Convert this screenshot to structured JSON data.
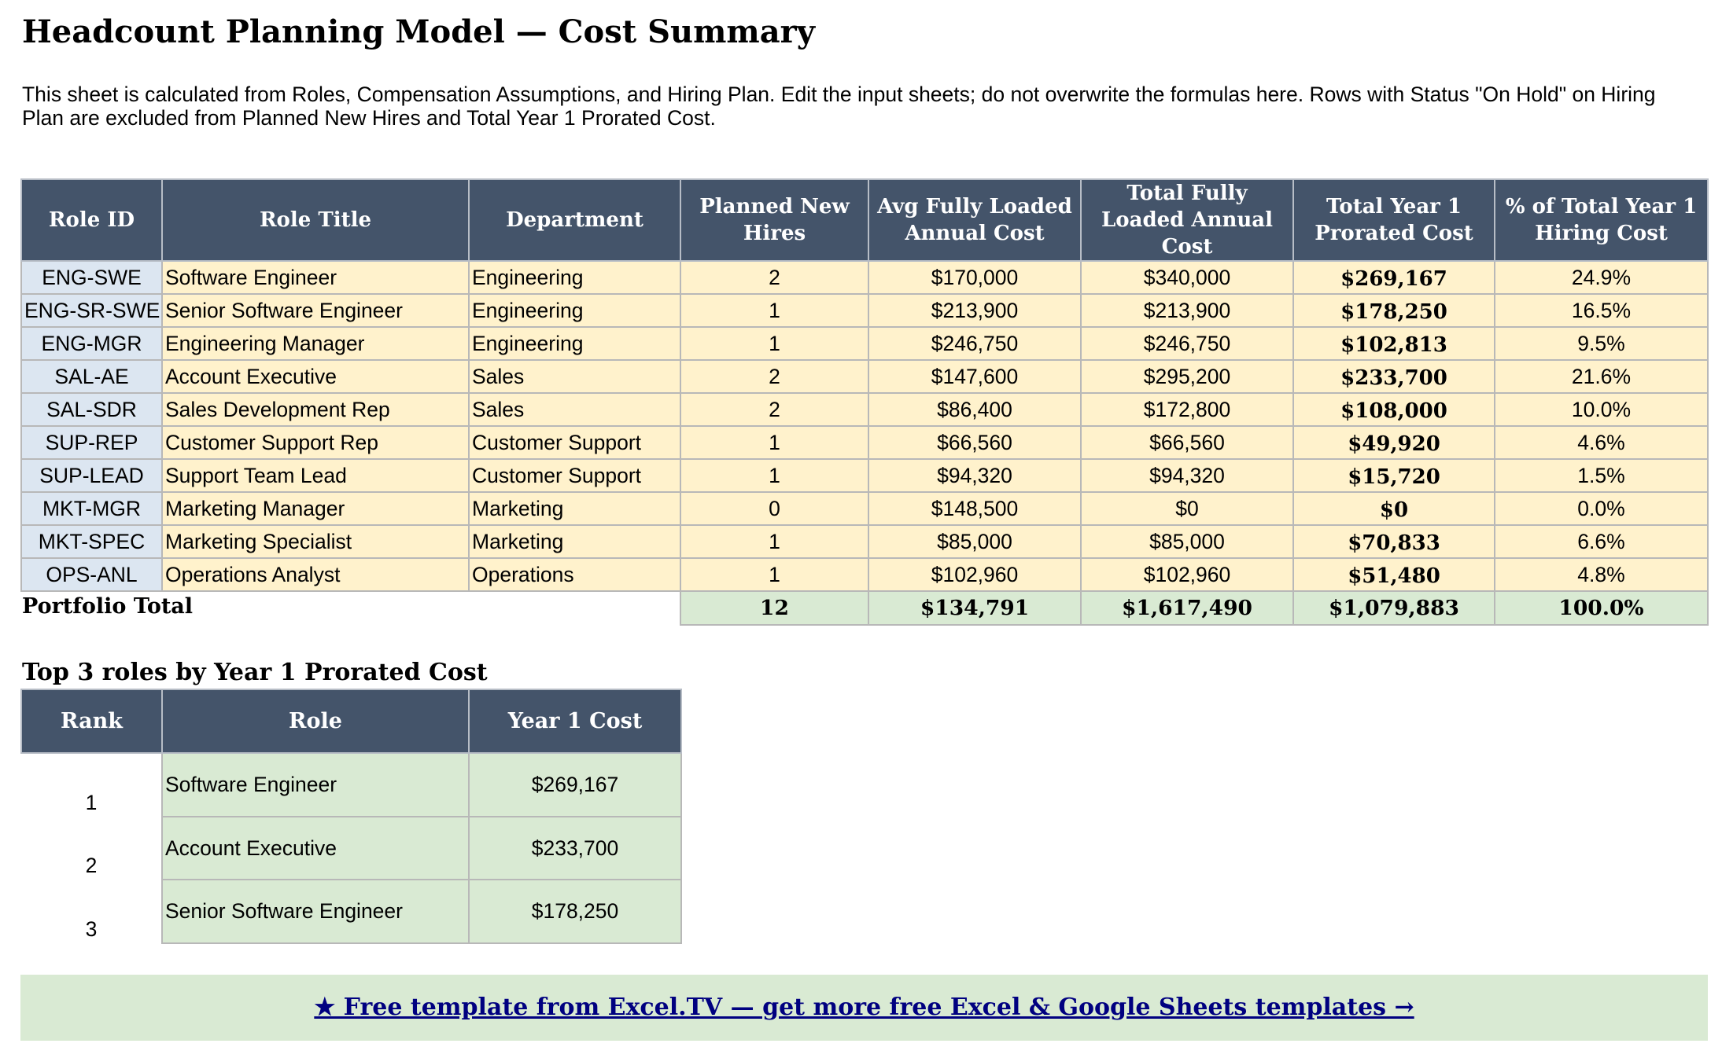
{
  "title": "Headcount Planning Model — Cost Summary",
  "description": "This sheet is calculated from Roles, Compensation Assumptions, and Hiring Plan. Edit the input sheets; do not overwrite the formulas here. Rows with Status \"On Hold\" on Hiring Plan are excluded from Planned New Hires and Total Year 1 Prorated Cost.",
  "columns": [
    "Role ID",
    "Role Title",
    "Department",
    "Planned New Hires",
    "Avg Fully Loaded Annual Cost",
    "Total Fully Loaded Annual Cost",
    "Total Year 1 Prorated Cost",
    "% of Total Year 1 Hiring Cost"
  ],
  "rows": [
    {
      "id": "ENG-SWE",
      "title": "Software Engineer",
      "dept": "Engineering",
      "hires": "2",
      "avg": "$170,000",
      "total": "$340,000",
      "year1": "$269,167",
      "pct": "24.9%"
    },
    {
      "id": "ENG-SR-SWE",
      "title": "Senior Software Engineer",
      "dept": "Engineering",
      "hires": "1",
      "avg": "$213,900",
      "total": "$213,900",
      "year1": "$178,250",
      "pct": "16.5%"
    },
    {
      "id": "ENG-MGR",
      "title": "Engineering Manager",
      "dept": "Engineering",
      "hires": "1",
      "avg": "$246,750",
      "total": "$246,750",
      "year1": "$102,813",
      "pct": "9.5%"
    },
    {
      "id": "SAL-AE",
      "title": "Account Executive",
      "dept": "Sales",
      "hires": "2",
      "avg": "$147,600",
      "total": "$295,200",
      "year1": "$233,700",
      "pct": "21.6%"
    },
    {
      "id": "SAL-SDR",
      "title": "Sales Development Rep",
      "dept": "Sales",
      "hires": "2",
      "avg": "$86,400",
      "total": "$172,800",
      "year1": "$108,000",
      "pct": "10.0%"
    },
    {
      "id": "SUP-REP",
      "title": "Customer Support Rep",
      "dept": "Customer Support",
      "hires": "1",
      "avg": "$66,560",
      "total": "$66,560",
      "year1": "$49,920",
      "pct": "4.6%"
    },
    {
      "id": "SUP-LEAD",
      "title": "Support Team Lead",
      "dept": "Customer Support",
      "hires": "1",
      "avg": "$94,320",
      "total": "$94,320",
      "year1": "$15,720",
      "pct": "1.5%"
    },
    {
      "id": "MKT-MGR",
      "title": "Marketing Manager",
      "dept": "Marketing",
      "hires": "0",
      "avg": "$148,500",
      "total": "$0",
      "year1": "$0",
      "pct": "0.0%"
    },
    {
      "id": "MKT-SPEC",
      "title": "Marketing Specialist",
      "dept": "Marketing",
      "hires": "1",
      "avg": "$85,000",
      "total": "$85,000",
      "year1": "$70,833",
      "pct": "6.6%"
    },
    {
      "id": "OPS-ANL",
      "title": "Operations Analyst",
      "dept": "Operations",
      "hires": "1",
      "avg": "$102,960",
      "total": "$102,960",
      "year1": "$51,480",
      "pct": "4.8%"
    }
  ],
  "portfolio": {
    "label": "Portfolio Total",
    "hires": "12",
    "avg": "$134,791",
    "total": "$1,617,490",
    "year1": "$1,079,883",
    "pct": "100.0%"
  },
  "top3": {
    "title": "Top 3 roles by Year 1 Prorated Cost",
    "columns": [
      "Rank",
      "Role",
      "Year 1 Cost"
    ],
    "rows": [
      {
        "rank": "1",
        "role": "Software Engineer",
        "cost": "$269,167"
      },
      {
        "rank": "2",
        "role": "Account Executive",
        "cost": "$233,700"
      },
      {
        "rank": "3",
        "role": "Senior Software Engineer",
        "cost": "$178,250"
      }
    ]
  },
  "banner": {
    "text": "★ Free template from Excel.TV — get more free Excel & Google Sheets templates →"
  },
  "colors": {
    "header": "#44546a",
    "id_cell": "#dce6f1",
    "input_cell": "#fff2cc",
    "total_cell": "#d9ead3",
    "link": "#000080"
  }
}
